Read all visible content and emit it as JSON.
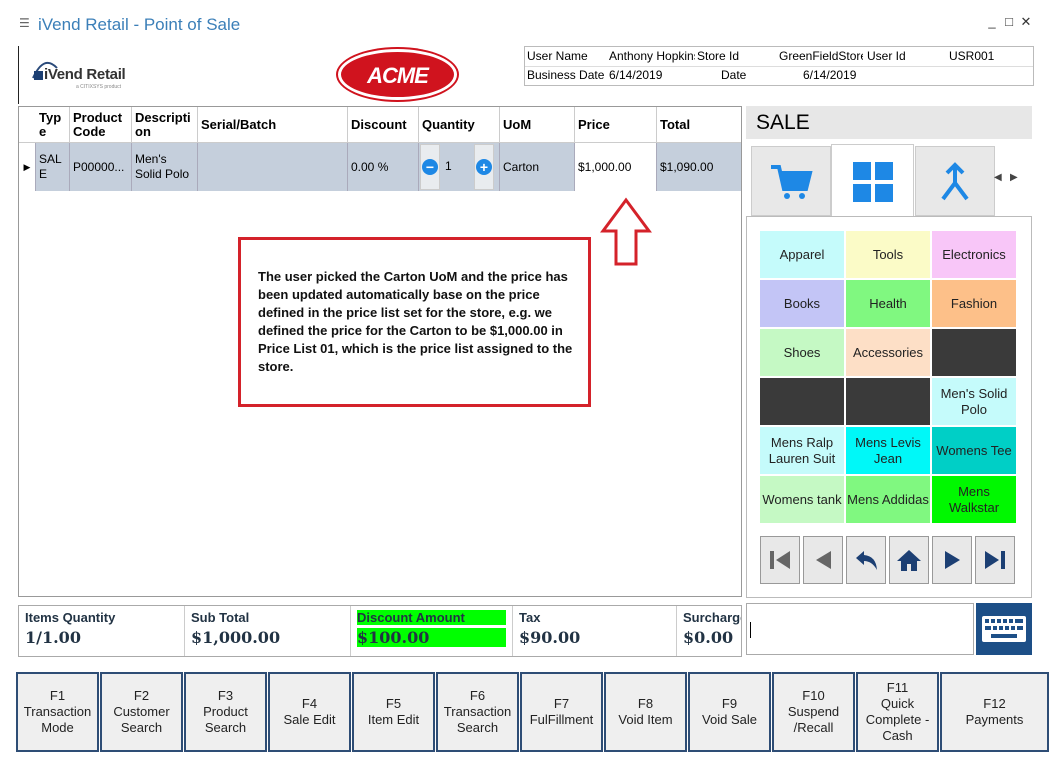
{
  "window": {
    "title": "iVend Retail - Point of Sale",
    "icon": "app-icon",
    "controls": [
      "_",
      "□",
      "✕"
    ]
  },
  "brand": {
    "logo_text": "iVend Retail",
    "logo_sub": "a CITIXSYS product",
    "store_logo": "ACME"
  },
  "info": {
    "user_name_label": "User Name",
    "user_name": "Anthony Hopkins",
    "store_id_label": "Store Id",
    "store_id": "GreenFieldStore",
    "user_id_label": "User Id",
    "user_id": "USR001",
    "business_date_label": "Business Date",
    "business_date": "6/14/2019",
    "date_label": "Date",
    "date": "6/14/2019"
  },
  "grid": {
    "headers": {
      "type": "Typ e",
      "product_code": "Product Code",
      "description": "Descripti on",
      "serial": "Serial/Batch",
      "discount": "Discount",
      "quantity": "Quantity",
      "uom": "UoM",
      "price": "Price",
      "total": "Total"
    },
    "row": {
      "type": "SAL E",
      "product_code": "P00000...",
      "description": "Men's Solid Polo",
      "serial": "",
      "discount": "0.00 %",
      "quantity": "1",
      "uom": "Carton",
      "price": "$1,000.00",
      "total": "$1,090.00"
    }
  },
  "annotation": {
    "text": "The user picked the Carton UoM and the price has been updated automatically base on the price defined in the price list set for the store, e.g. we defined the price for the Carton to be $1,000.00 in Price List 01, which is the price list assigned to the store."
  },
  "sale_panel": {
    "title": "SALE",
    "tabs": [
      "cart-icon",
      "grid-icon",
      "merge-arrow-icon"
    ],
    "categories": [
      {
        "label": "Apparel",
        "color": "#c5fbfb"
      },
      {
        "label": "Tools",
        "color": "#fbfbc7"
      },
      {
        "label": "Electronics",
        "color": "#f8c6f8"
      },
      {
        "label": "Books",
        "color": "#c3c5f6"
      },
      {
        "label": "Health",
        "color": "#80f880"
      },
      {
        "label": "Fashion",
        "color": "#fdc089"
      },
      {
        "label": "Shoes",
        "color": "#c5f9c4"
      },
      {
        "label": "Accessories",
        "color": "#fddfc6"
      },
      {
        "label": "",
        "color": "#3a3a3a"
      },
      {
        "label": "",
        "color": "#3a3a3a"
      },
      {
        "label": "",
        "color": "#3a3a3a"
      },
      {
        "label": "Men's Solid Polo",
        "color": "#c5fbfb"
      },
      {
        "label": "Mens Ralp Lauren Suit",
        "color": "#c5fbfb"
      },
      {
        "label": "Mens Levis Jean",
        "color": "#00f8f8"
      },
      {
        "label": "Womens Tee",
        "color": "#00cfc6"
      },
      {
        "label": "Womens tank",
        "color": "#c5f9c4"
      },
      {
        "label": "Mens Addidas",
        "color": "#80f880"
      },
      {
        "label": "Mens Walkstar",
        "color": "#00f800"
      }
    ],
    "nav": [
      "first-icon",
      "prev-icon",
      "back-icon",
      "home-icon",
      "next-icon",
      "last-icon"
    ]
  },
  "totals": [
    {
      "label": "Items Quantity",
      "value": "1/1.00",
      "highlight": false
    },
    {
      "label": "Sub Total",
      "value": "$1,000.00",
      "highlight": false
    },
    {
      "label": "Discount Amount",
      "value": "$100.00",
      "highlight": true
    },
    {
      "label": "Tax",
      "value": "$90.00",
      "highlight": false
    },
    {
      "label": "Surcharge",
      "value": "$0.00",
      "highlight": false
    }
  ],
  "fkeys": [
    "F1\nTransaction\nMode",
    "F2\nCustomer\nSearch",
    "F3\nProduct\nSearch",
    "F4\nSale Edit",
    "F5\nItem Edit",
    "F6\nTransaction\nSearch",
    "F7\nFulFillment",
    "F8\nVoid Item",
    "F9\nVoid Sale",
    "F10\nSuspend\n/Recall",
    "F11\nQuick\nComplete -\nCash",
    "F12\nPayments"
  ]
}
